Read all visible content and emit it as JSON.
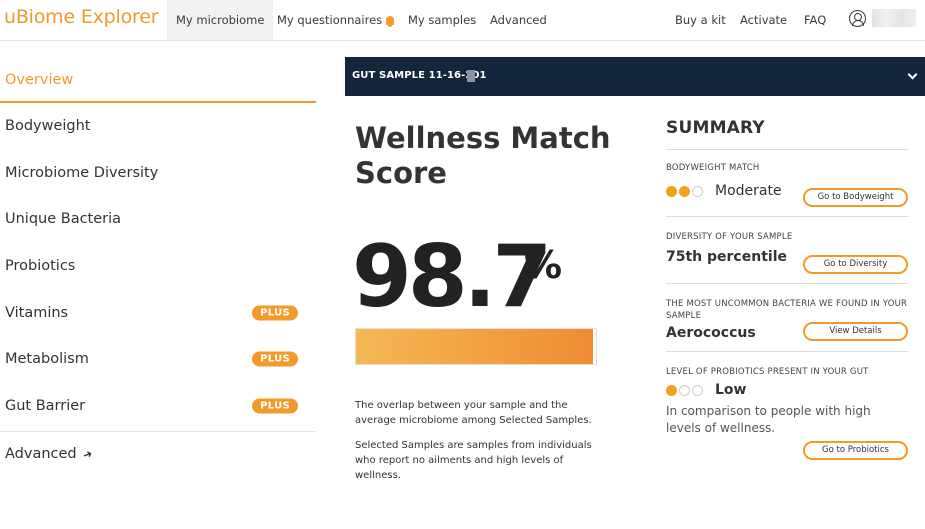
{
  "nav": {
    "logo": "uBiome Explorer",
    "left_links": [
      "My microbiome",
      "My questionnaires",
      "My samples",
      "Advanced"
    ],
    "right_links": [
      "Buy a kit",
      "Activate",
      "FAQ"
    ]
  },
  "sidebar": {
    "items": [
      {
        "label": "Overview"
      },
      {
        "label": "Bodyweight"
      },
      {
        "label": "Microbiome Diversity"
      },
      {
        "label": "Unique Bacteria"
      },
      {
        "label": "Probiotics"
      },
      {
        "label": "Vitamins",
        "badge": "PLUS"
      },
      {
        "label": "Metabolism",
        "badge": "PLUS"
      },
      {
        "label": "Gut Barrier",
        "badge": "PLUS"
      }
    ],
    "advanced_label": "Advanced"
  },
  "sample": {
    "title": "GUT SAMPLE 11-16-201"
  },
  "score": {
    "title": "Wellness Match Score",
    "value": "98.7",
    "unit": "%",
    "fill_percent": 98.7,
    "description1": "The overlap between your sample and the average microbiome among Selected Samples.",
    "description2": "Selected Samples are samples from individuals who report no ailments and high levels of wellness."
  },
  "summary": {
    "title": "SUMMARY",
    "bodyweight": {
      "label": "BODYWEIGHT MATCH",
      "value": "Moderate",
      "dots_on": 2,
      "dots_total": 3,
      "button": "Go to Bodyweight"
    },
    "diversity": {
      "label": "DIVERSITY OF YOUR SAMPLE",
      "value": "75th percentile",
      "button": "Go to Diversity"
    },
    "bacteria": {
      "label": "THE MOST UNCOMMON BACTERIA WE FOUND IN YOUR SAMPLE",
      "value": "Aerococcus",
      "button": "View Details"
    },
    "probiotics": {
      "label": "LEVEL OF PROBIOTICS PRESENT IN YOUR GUT",
      "value": "Low",
      "dots_on": 1,
      "dots_total": 3,
      "note": "In comparison to people with high levels of wellness.",
      "button": "Go to Probiotics"
    }
  },
  "colors": {
    "accent": "#f39a2b",
    "header_bar": "#12273b"
  }
}
